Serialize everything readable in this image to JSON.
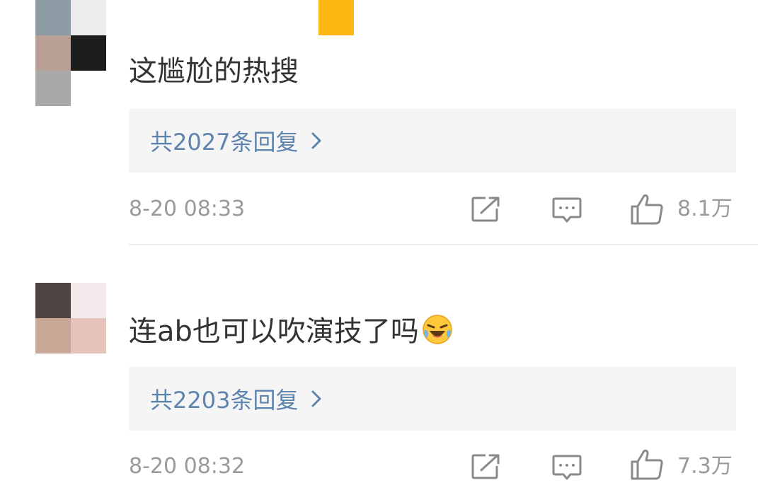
{
  "comments": [
    {
      "text": "这尴尬的热搜",
      "replies_label": "共2027条回复",
      "timestamp": "8-20 08:33",
      "likes": "8.1万",
      "avatar_icon": "pixelated-avatar",
      "actions": [
        "share-icon",
        "comment-icon",
        "like-icon"
      ]
    },
    {
      "text": "连ab也可以吹演技了吗",
      "emoji": "laughing-crying-emoji",
      "replies_label": "共2203条回复",
      "timestamp": "8-20 08:32",
      "likes": "7.3万",
      "avatar_icon": "pixelated-avatar",
      "actions": [
        "share-icon",
        "comment-icon",
        "like-icon"
      ]
    }
  ],
  "colors": {
    "reply_link": "#5d84ad",
    "reply_bg": "#f5f5f6",
    "meta_text": "#9a9a9a",
    "body_text": "#333333",
    "accent": "#FDB813"
  }
}
